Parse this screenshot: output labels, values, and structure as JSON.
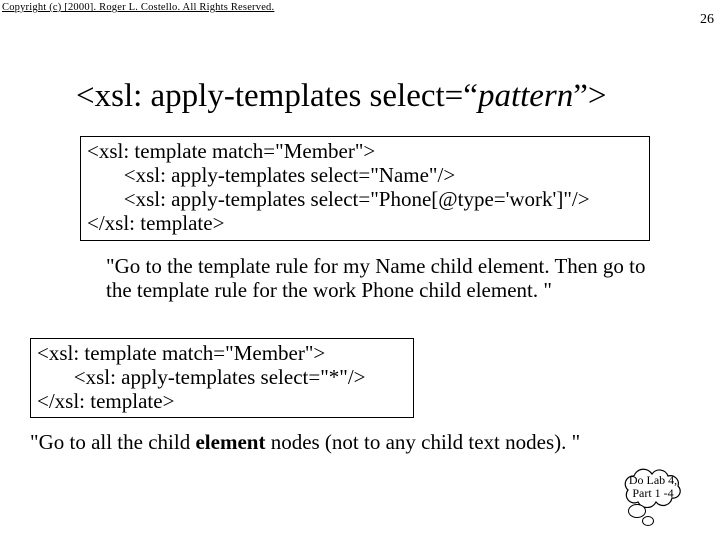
{
  "header": {
    "copyright": "Copyright (c) [2000].  Roger L. Costello. All Rights Reserved.",
    "page_number": "26"
  },
  "title": {
    "prefix": "<xsl: apply-templates select=“",
    "pattern": "pattern",
    "suffix": "”>"
  },
  "example1": {
    "code_line1": "<xsl: template match=\"Member\">",
    "code_line2": "       <xsl: apply-templates select=\"Name\"/>",
    "code_line3": "       <xsl: apply-templates select=\"Phone[@type='work']\"/>",
    "code_line4": "</xsl: template>",
    "explanation": "\"Go to the template rule for my Name child element.  Then go to the template rule for the work Phone child element. \""
  },
  "example2": {
    "code_line1": "<xsl: template match=\"Member\">",
    "code_line2": "       <xsl: apply-templates select=\"*\"/>",
    "code_line3": "</xsl: template>",
    "explanation_pre": "\"Go to all the child ",
    "explanation_bold": "element",
    "explanation_post": " nodes (not to any child text nodes). \""
  },
  "callout": {
    "line1": "Do Lab 4,",
    "line2": "Part 1 -4"
  }
}
